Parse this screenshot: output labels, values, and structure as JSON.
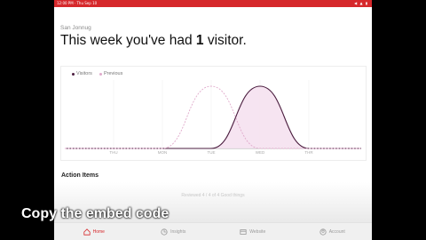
{
  "status_bar": {
    "left": "12:00 PM · Thu Sep 10",
    "right": "◀ ▲ ▮"
  },
  "greeting": "San Jonnug",
  "headline": {
    "prefix": "This week you've had",
    "count": "1",
    "suffix": "visitor."
  },
  "chart_data": {
    "type": "line",
    "categories": [
      "THU",
      "MON",
      "TUE",
      "WED",
      "THR"
    ],
    "series": [
      {
        "name": "Visitors",
        "values": [
          0,
          0,
          0,
          1,
          0
        ],
        "style": "solid",
        "color": "#4b1d3f"
      },
      {
        "name": "Previous",
        "values": [
          0,
          0,
          1,
          0,
          0
        ],
        "style": "dashed",
        "color": "#e0aacb"
      }
    ],
    "ylim": [
      0,
      1
    ],
    "legend": "top-left",
    "grid": true
  },
  "colors": {
    "accent": "#d6282b",
    "visitors": "#4b1d3f",
    "previous": "#e0aacb",
    "visitors_fill": "#f5e1ef"
  },
  "action_items": {
    "title": "Action Items",
    "subtitle": "Reviewed 4 / 4 of 4 Good things"
  },
  "caption": "Copy the embed code",
  "tabs": [
    {
      "label": "Home",
      "icon": "home-icon",
      "active": true
    },
    {
      "label": "Insights",
      "icon": "insights-icon",
      "active": false
    },
    {
      "label": "Website",
      "icon": "website-icon",
      "active": false
    },
    {
      "label": "Account",
      "icon": "account-icon",
      "active": false
    }
  ]
}
